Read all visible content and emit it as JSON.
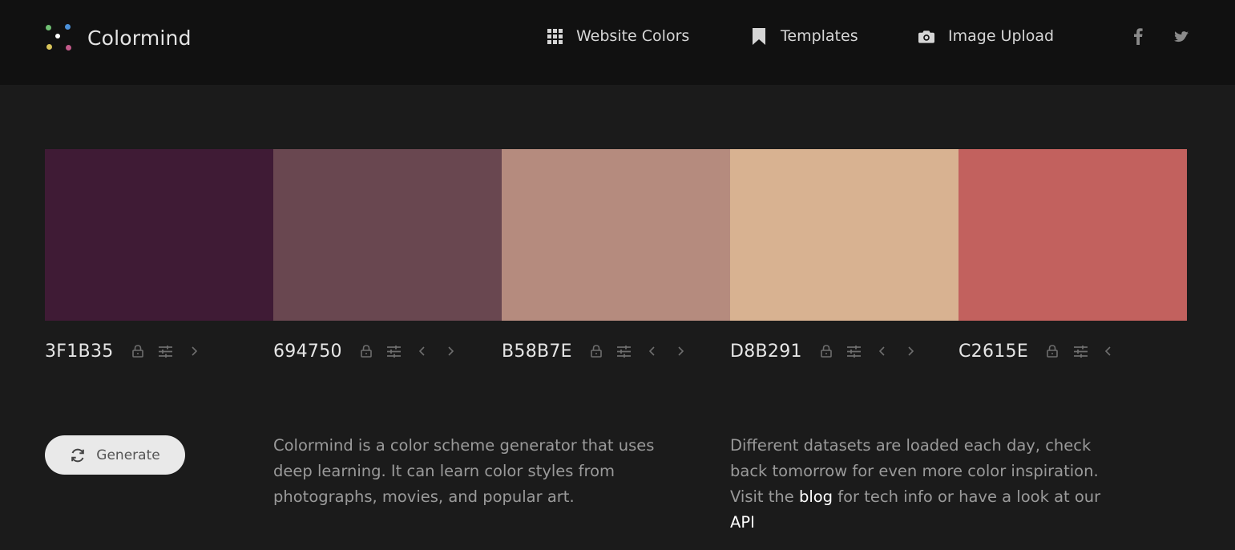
{
  "header": {
    "logo_text": "Colormind",
    "nav": [
      {
        "label": "Website Colors",
        "icon": "grid-icon"
      },
      {
        "label": "Templates",
        "icon": "bookmark-icon"
      },
      {
        "label": "Image Upload",
        "icon": "camera-icon"
      }
    ],
    "social": [
      {
        "icon": "facebook-icon"
      },
      {
        "icon": "twitter-icon"
      }
    ]
  },
  "palette": [
    {
      "hex": "3F1B35",
      "color": "#3F1B35"
    },
    {
      "hex": "694750",
      "color": "#694750"
    },
    {
      "hex": "B58B7E",
      "color": "#B58B7E"
    },
    {
      "hex": "D8B291",
      "color": "#D8B291"
    },
    {
      "hex": "C2615E",
      "color": "#C2615E"
    }
  ],
  "generate_label": "Generate",
  "description_left": "Colormind is a color scheme generator that uses deep learning. It can learn color styles from photographs, movies, and popular art.",
  "description_right": {
    "text_1": "Different datasets are loaded each day, check back tomorrow for even more color inspiration. Visit the ",
    "link_blog": "blog",
    "text_2": " for tech info or have a look at our ",
    "link_api": "API"
  }
}
